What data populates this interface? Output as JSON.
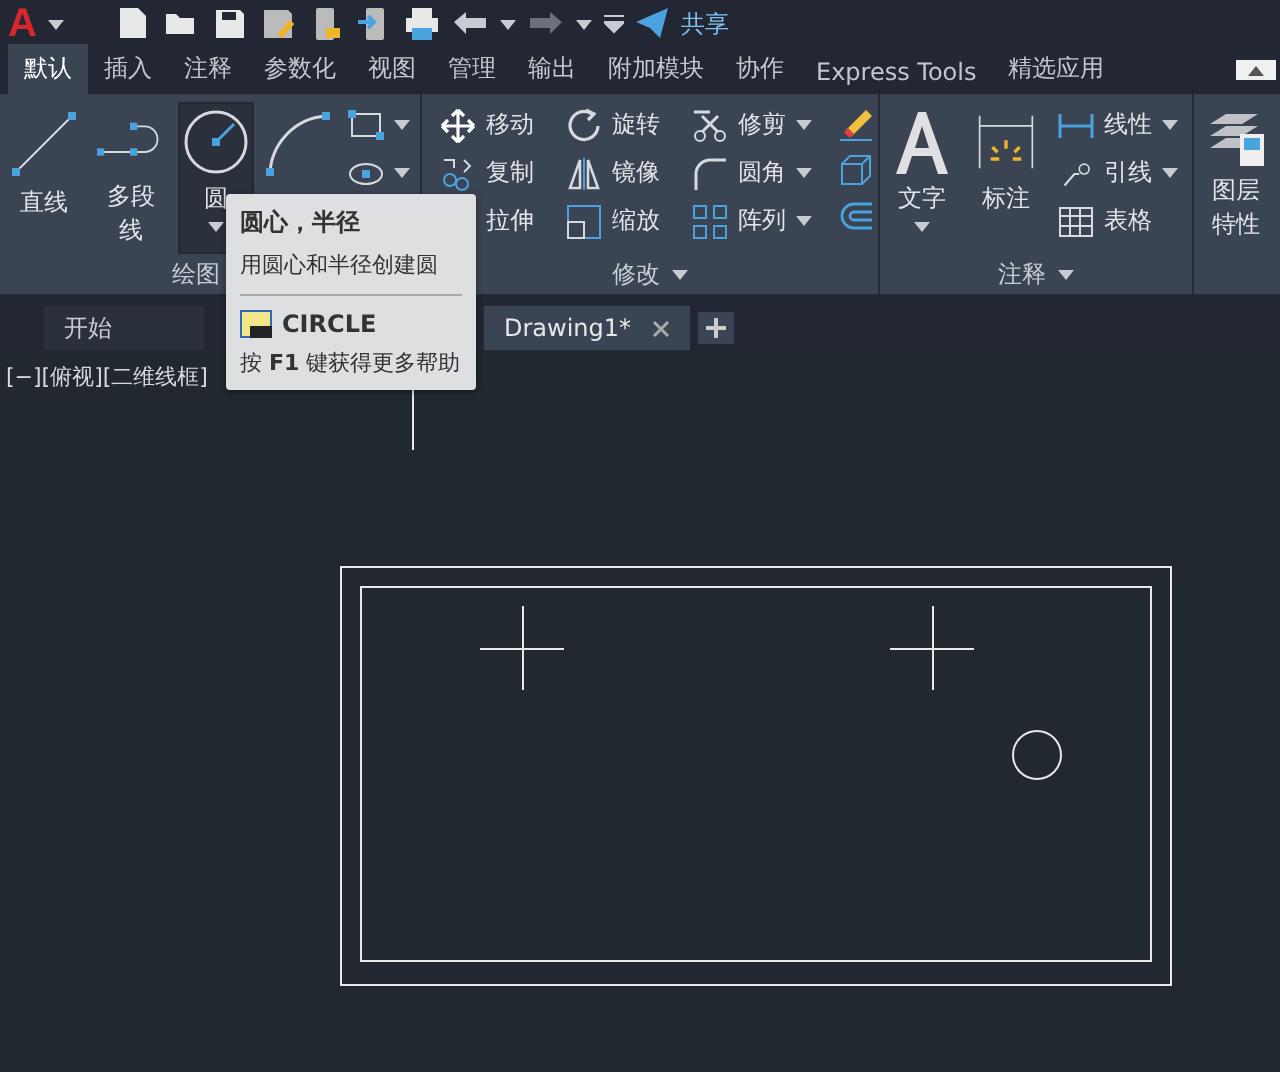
{
  "title_bar": {
    "logo": "A",
    "share_label": "共享"
  },
  "ribbon_tabs": [
    {
      "label": "默认",
      "selected": true
    },
    {
      "label": "插入",
      "selected": false
    },
    {
      "label": "注释",
      "selected": false
    },
    {
      "label": "参数化",
      "selected": false
    },
    {
      "label": "视图",
      "selected": false
    },
    {
      "label": "管理",
      "selected": false
    },
    {
      "label": "输出",
      "selected": false
    },
    {
      "label": "附加模块",
      "selected": false
    },
    {
      "label": "协作",
      "selected": false
    },
    {
      "label": "Express Tools",
      "selected": false
    },
    {
      "label": "精选应用",
      "selected": false
    }
  ],
  "draw_panel": {
    "title": "绘图",
    "tools": [
      {
        "kind": "line",
        "label": "直线",
        "active": false
      },
      {
        "kind": "polyline",
        "label": "多段线",
        "active": false
      },
      {
        "kind": "circle",
        "label": "圆",
        "active": true
      },
      {
        "kind": "arc",
        "active": false
      }
    ]
  },
  "modify_panel": {
    "title": "修改",
    "columns": [
      [
        {
          "kind": "move",
          "label": "移动"
        },
        {
          "kind": "copy",
          "label": "复制"
        },
        {
          "kind": "stretch",
          "label": "拉伸"
        }
      ],
      [
        {
          "kind": "rotate",
          "label": "旋转"
        },
        {
          "kind": "mirror",
          "label": "镜像"
        },
        {
          "kind": "scale",
          "label": "缩放"
        }
      ],
      [
        {
          "kind": "trim",
          "label": "修剪"
        },
        {
          "kind": "fillet",
          "label": "圆角"
        },
        {
          "kind": "array",
          "label": "阵列"
        }
      ]
    ]
  },
  "annotation_panel": {
    "title": "注释",
    "tools": [
      {
        "kind": "text",
        "label": "文字"
      },
      {
        "kind": "dimension",
        "label": "标注"
      }
    ],
    "small_tools": [
      {
        "kind": "linear",
        "label": "线性"
      },
      {
        "kind": "leader",
        "label": "引线"
      },
      {
        "kind": "table",
        "label": "表格"
      }
    ]
  },
  "layers_panel": {
    "tool_label": "图层特性"
  },
  "document_tabs": [
    {
      "label": "开始",
      "selected": false
    },
    {
      "label": "Drawing1*",
      "selected": true
    }
  ],
  "viewport_label": "[−][俯视][二维线框]",
  "tooltip": {
    "title": "圆心，半径",
    "description": "用圆心和半径创建圆",
    "command": "CIRCLE",
    "help": "按 **F1** 键获得更多帮助"
  }
}
